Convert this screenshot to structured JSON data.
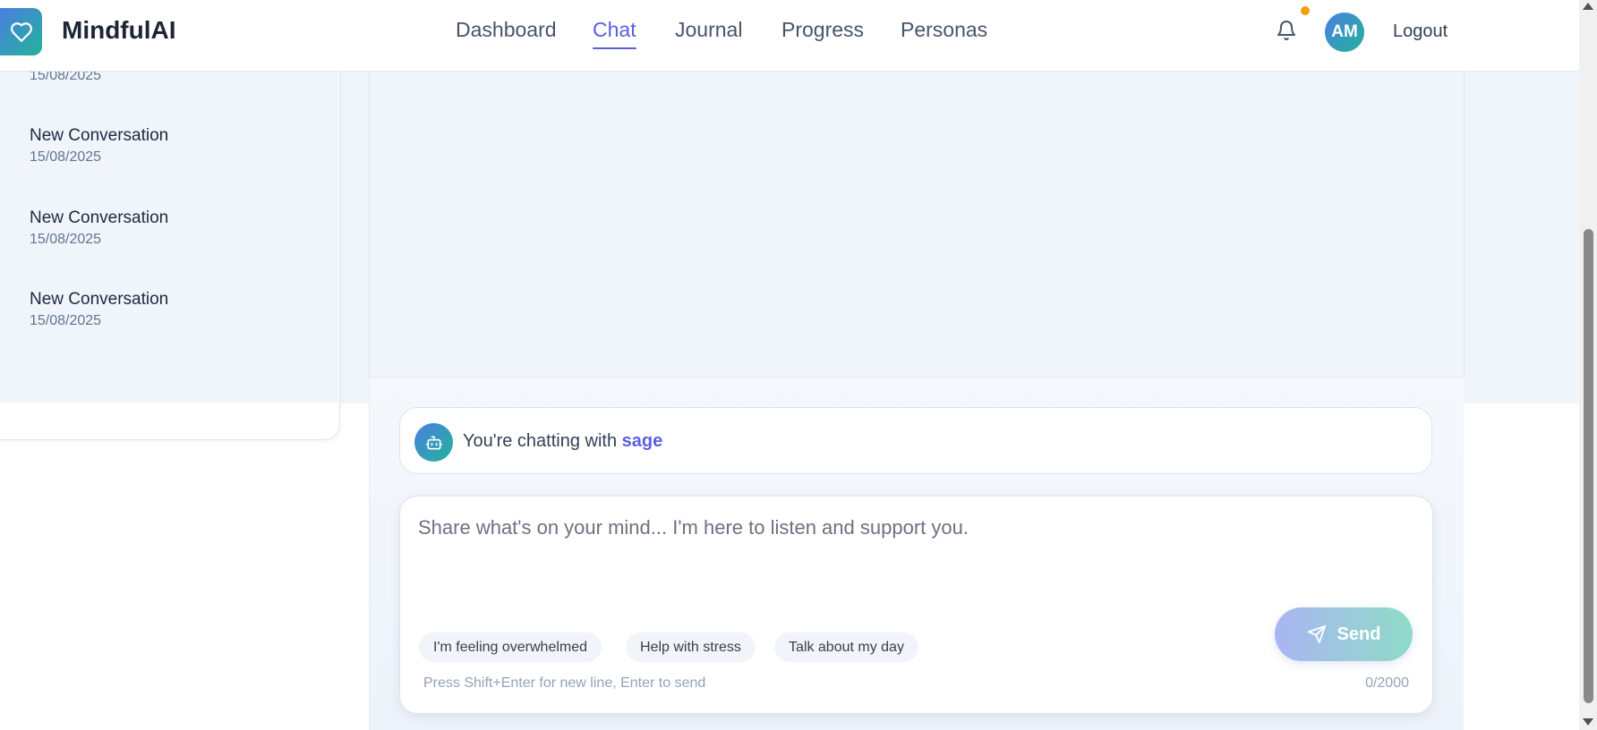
{
  "app": {
    "name": "MindfulAI"
  },
  "nav": {
    "items": [
      {
        "label": "Dashboard",
        "active": false
      },
      {
        "label": "Chat",
        "active": true
      },
      {
        "label": "Journal",
        "active": false
      },
      {
        "label": "Progress",
        "active": false
      },
      {
        "label": "Personas",
        "active": false
      }
    ]
  },
  "user": {
    "initials": "AM",
    "logout_label": "Logout",
    "has_notification": true
  },
  "sidebar": {
    "conversations": [
      {
        "title": "",
        "date": "15/08/2025"
      },
      {
        "title": "New Conversation",
        "date": "15/08/2025"
      },
      {
        "title": "New Conversation",
        "date": "15/08/2025"
      },
      {
        "title": "New Conversation",
        "date": "15/08/2025"
      }
    ]
  },
  "chat": {
    "chatting_with_prefix": "You're chatting with",
    "persona": "sage"
  },
  "composer": {
    "placeholder": "Share what's on your mind... I'm here to listen and support you.",
    "value": "",
    "suggestions": [
      "I'm feeling overwhelmed",
      "Help with stress",
      "Talk about my day"
    ],
    "send_label": "Send",
    "hint": "Press Shift+Enter for new line, Enter to send",
    "char_count": "0/2000"
  },
  "colors": {
    "accent": "#5b5ee0",
    "brand_gradient_start": "#4a7fe0",
    "brand_gradient_end": "#23b39a",
    "notification_dot": "#f59e0b"
  },
  "icons": {
    "logo": "heart-icon",
    "notification": "bell-icon",
    "bot": "robot-icon",
    "send": "paper-plane-icon"
  }
}
